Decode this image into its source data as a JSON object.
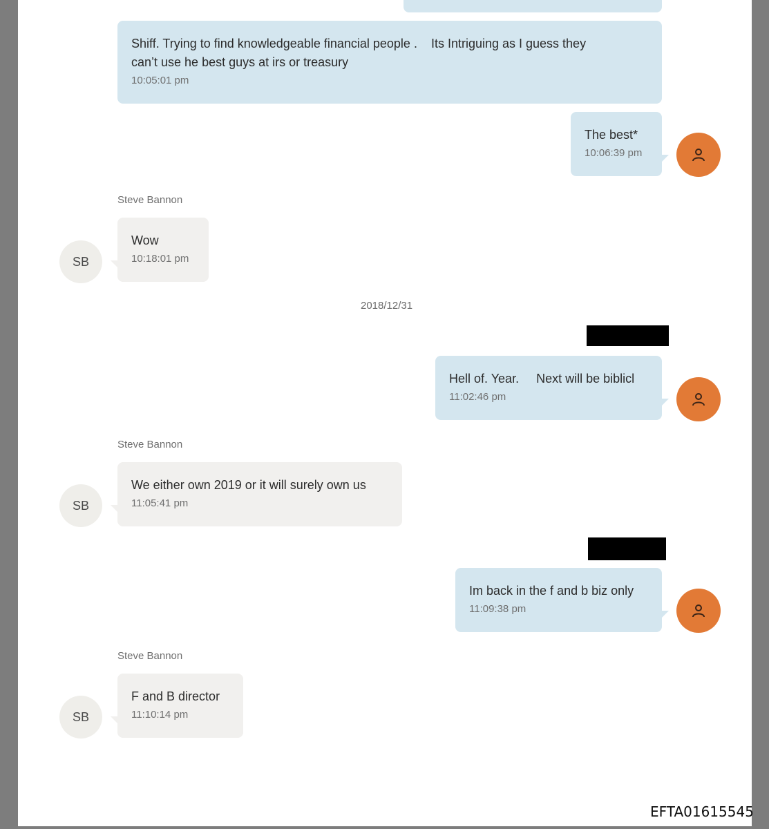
{
  "messages": [
    {
      "direction": "outgoing",
      "text": "",
      "time": ""
    },
    {
      "direction": "outgoing",
      "text": "Shiff. Trying to find knowledgeable financial people .    Its Intriguing as I guess they\ncan’t use he best guys at irs or treasury",
      "time": "10:05:01 pm"
    },
    {
      "direction": "outgoing",
      "text": "The best*",
      "time": "10:06:39 pm"
    },
    {
      "direction": "incoming",
      "sender": "Steve Bannon",
      "initials": "SB",
      "text": "Wow",
      "time": "10:18:01 pm"
    },
    {
      "direction": "outgoing",
      "text": "Hell of. Year.     Next will be biblicl",
      "time": "11:02:46 pm"
    },
    {
      "direction": "incoming",
      "sender": "Steve Bannon",
      "initials": "SB",
      "text": "We either own 2019 or it will surely own us",
      "time": "11:05:41 pm"
    },
    {
      "direction": "outgoing",
      "text": "Im back in the f and b biz only",
      "time": "11:09:38 pm"
    },
    {
      "direction": "incoming",
      "sender": "Steve Bannon",
      "initials": "SB",
      "text": "F and B director",
      "time": "11:10:14 pm"
    }
  ],
  "date_separator": "2018/12/31",
  "document_id": "EFTA01615545",
  "icons": {
    "outgoing_avatar": "person-outline-icon"
  },
  "colors": {
    "outgoing_bubble": "#d4e6ef",
    "incoming_bubble": "#f1f0ee",
    "outgoing_avatar": "#e27a36",
    "incoming_avatar": "#efeeea",
    "redaction": "#000000"
  }
}
